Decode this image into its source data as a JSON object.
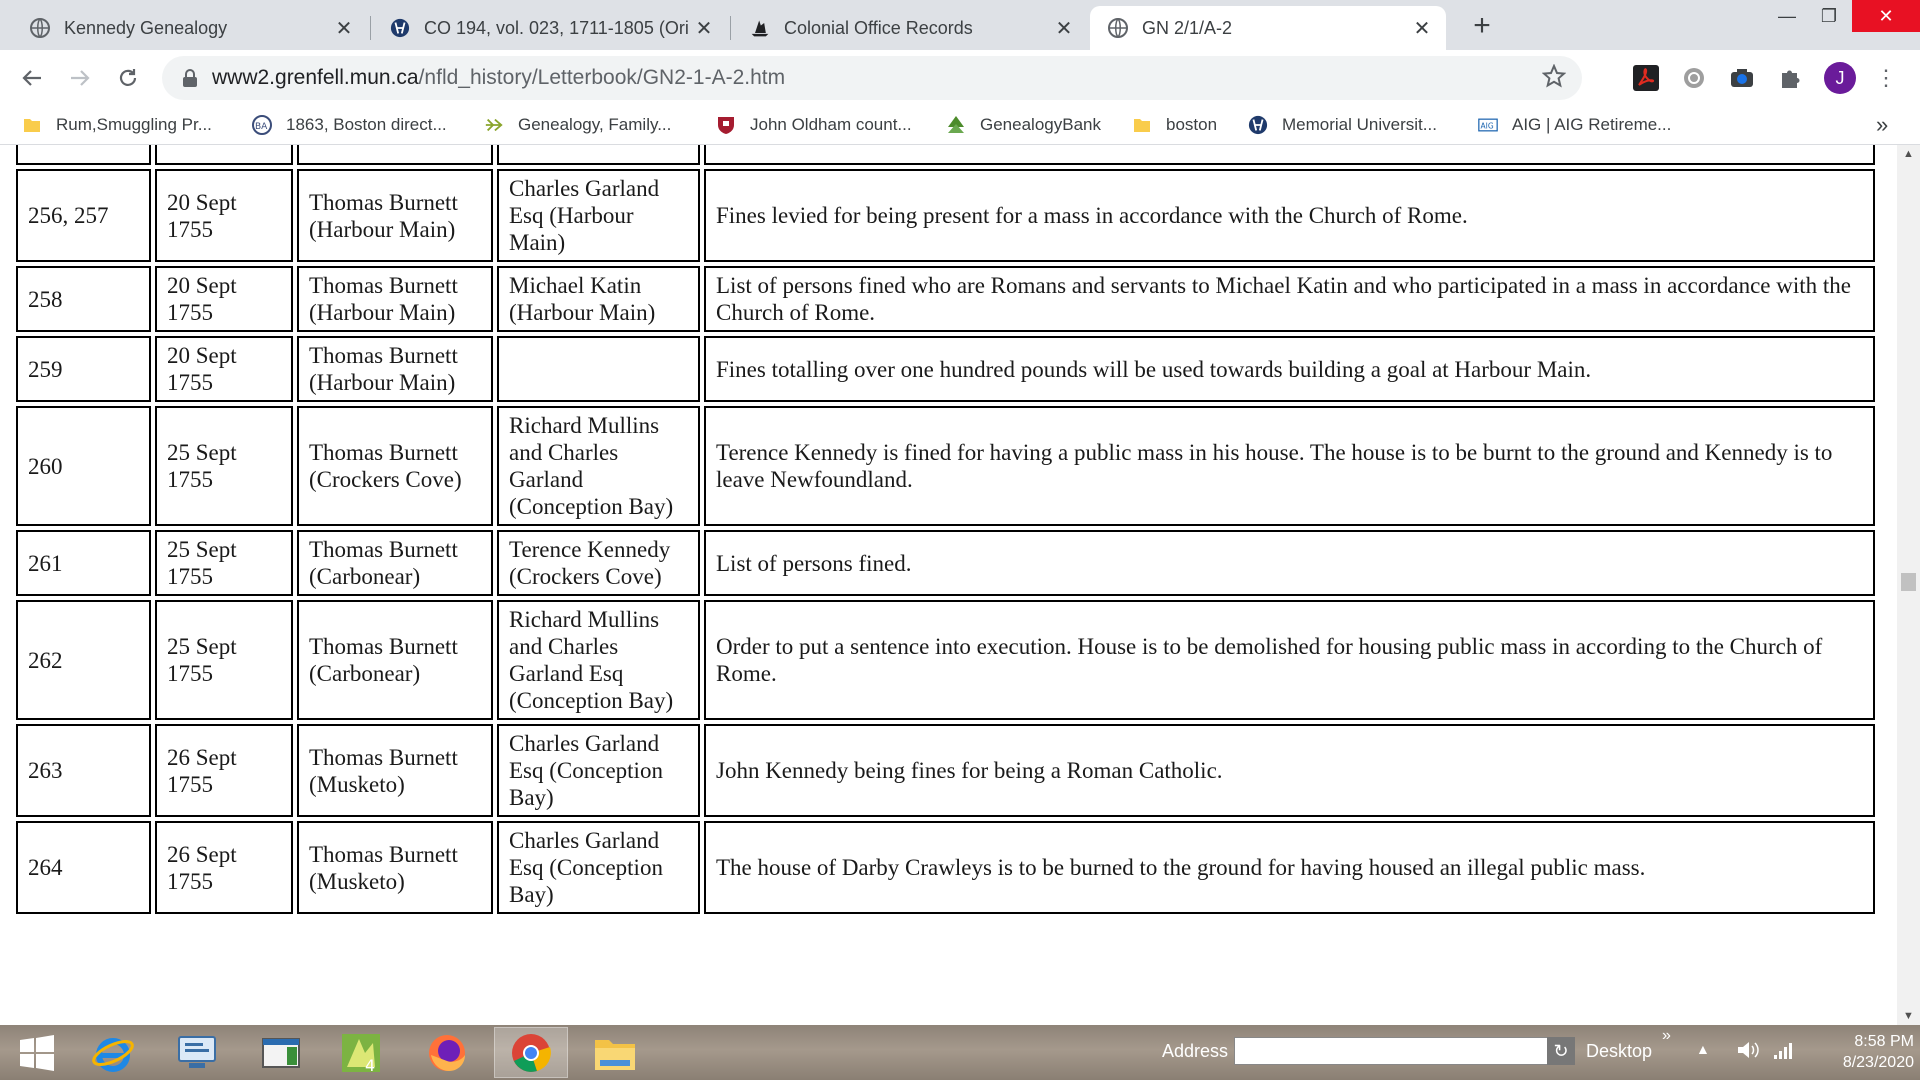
{
  "browser": {
    "tabs": [
      {
        "title": "Kennedy Genealogy",
        "icon": "globe-icon",
        "active": false
      },
      {
        "title": "CO 194, vol. 023, 1711-1805 (Ori",
        "icon": "mun-logo-icon",
        "active": false
      },
      {
        "title": "Colonial Office Records",
        "icon": "ship-icon",
        "active": false
      },
      {
        "title": "GN 2/1/A-2",
        "icon": "globe-icon",
        "active": true
      }
    ],
    "new_tab": "+",
    "close_glyph": "✕",
    "window_controls": {
      "minimize": "—",
      "restore": "❐",
      "close": "✕"
    },
    "url": {
      "host": "www2.grenfell.mun.ca",
      "path": "/nfld_history/Letterbook/GN2-1-A-2.htm"
    },
    "profile_initial": "J",
    "bookmarks": [
      {
        "label": "Rum,Smuggling Pr...",
        "icon": "folder-icon"
      },
      {
        "label": "1863, Boston direct...",
        "icon": "ba-logo-icon"
      },
      {
        "label": "Genealogy, Family...",
        "icon": "arrow-logo-icon"
      },
      {
        "label": "John Oldham count...",
        "icon": "shield-icon"
      },
      {
        "label": "GenealogyBank",
        "icon": "tree-icon"
      },
      {
        "label": "boston",
        "icon": "folder-icon"
      },
      {
        "label": "Memorial Universit...",
        "icon": "mun-logo-icon"
      },
      {
        "label": "AIG | AIG Retireme...",
        "icon": "aig-logo-icon"
      }
    ],
    "bookmarks_overflow": "»"
  },
  "table": {
    "rows": [
      {
        "ref": "",
        "date": "",
        "from": "",
        "to": "",
        "summary": ""
      },
      {
        "ref": "256, 257",
        "date": "20 Sept 1755",
        "from": "Thomas Burnett (Harbour Main)",
        "to": "Charles Garland Esq (Harbour Main)",
        "summary": "Fines levied for being present for a mass in accordance with the Church of Rome."
      },
      {
        "ref": "258",
        "date": "20 Sept 1755",
        "from": "Thomas Burnett (Harbour Main)",
        "to": "Michael Katin (Harbour Main)",
        "summary": "List of persons fined who are Romans and servants to Michael Katin and who participated in a mass in accordance with the Church of Rome."
      },
      {
        "ref": "259",
        "date": "20 Sept 1755",
        "from": "Thomas Burnett (Harbour Main)",
        "to": "",
        "summary": "Fines totalling over one hundred pounds will be used towards building a goal at Harbour Main."
      },
      {
        "ref": "260",
        "date": "25 Sept 1755",
        "from": "Thomas Burnett (Crockers Cove)",
        "to": "Richard Mullins and Charles Garland (Conception Bay)",
        "summary": "Terence Kennedy is fined for having a public mass in his house. The house is to be burnt to the ground and Kennedy is to leave Newfoundland."
      },
      {
        "ref": "261",
        "date": "25 Sept 1755",
        "from": "Thomas Burnett (Carbonear)",
        "to": "Terence Kennedy (Crockers Cove)",
        "summary": "List of persons fined."
      },
      {
        "ref": "262",
        "date": "25 Sept 1755",
        "from": "Thomas Burnett (Carbonear)",
        "to": "Richard Mullins and Charles Garland Esq (Conception Bay)",
        "summary": "Order to put a sentence into execution. House is to be demolished for housing public mass in according to the Church of Rome."
      },
      {
        "ref": "263",
        "date": "26 Sept 1755",
        "from": "Thomas Burnett (Musketo)",
        "to": "Charles Garland Esq (Conception Bay)",
        "summary": "John Kennedy being fines for being a Roman Catholic."
      },
      {
        "ref": "264",
        "date": "26 Sept 1755",
        "from": "Thomas Burnett (Musketo)",
        "to": "Charles Garland Esq (Conception Bay)",
        "summary": "The house of Darby Crawleys is to be burned to the ground for having housed an illegal public mass."
      }
    ]
  },
  "taskbar": {
    "apps": [
      "windows-start-icon",
      "internet-explorer-icon",
      "remote-desktop-icon",
      "windows-explorer-icon",
      "app4-icon",
      "firefox-icon",
      "chrome-icon",
      "file-explorer-icon"
    ],
    "address_label": "Address",
    "address_value": "",
    "desktop_label": "Desktop",
    "overflow": "»",
    "time": "8:58 PM",
    "date": "8/23/2020"
  }
}
